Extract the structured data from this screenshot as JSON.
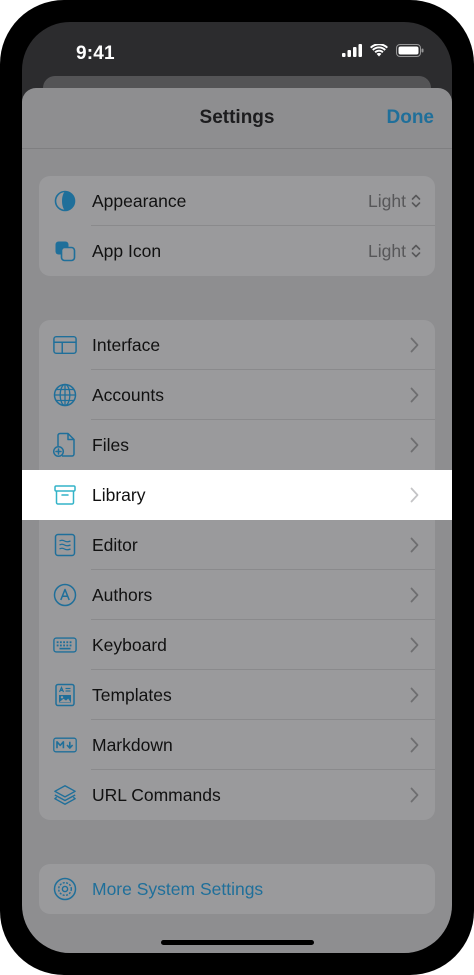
{
  "status": {
    "time": "9:41",
    "icons": [
      "cellular-signal-icon",
      "wifi-icon",
      "battery-icon"
    ]
  },
  "nav": {
    "title": "Settings",
    "done_label": "Done"
  },
  "colors": {
    "accent": "#1f6f9a",
    "dimmed_background": "#8e8e90",
    "group_background": "#9a9a9c",
    "highlight_background": "#ffffff"
  },
  "appearance_group": [
    {
      "label": "Appearance",
      "value": "Light",
      "icon": "appearance-icon"
    },
    {
      "label": "App Icon",
      "value": "Light",
      "icon": "app-icon-icon"
    }
  ],
  "settings_group": [
    {
      "label": "Interface",
      "icon": "interface-icon"
    },
    {
      "label": "Accounts",
      "icon": "globe-icon"
    },
    {
      "label": "Files",
      "icon": "file-add-icon"
    },
    {
      "label": "Library",
      "icon": "archive-box-icon",
      "highlighted": true
    },
    {
      "label": "Editor",
      "icon": "editor-icon"
    },
    {
      "label": "Authors",
      "icon": "author-icon"
    },
    {
      "label": "Keyboard",
      "icon": "keyboard-icon"
    },
    {
      "label": "Templates",
      "icon": "template-icon"
    },
    {
      "label": "Markdown",
      "icon": "markdown-icon"
    },
    {
      "label": "URL Commands",
      "icon": "layers-icon"
    }
  ],
  "system_group": {
    "label": "More System Settings",
    "icon": "system-settings-icon"
  }
}
